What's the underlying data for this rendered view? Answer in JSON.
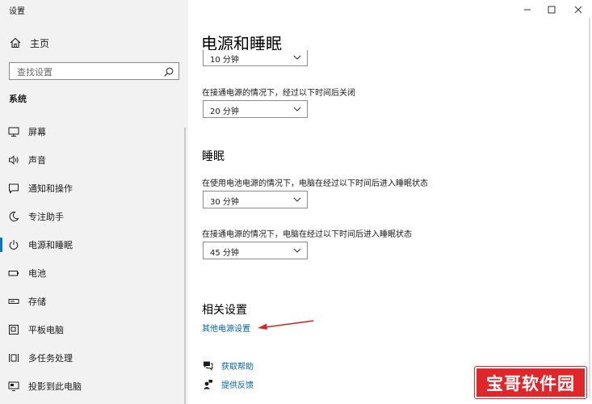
{
  "window": {
    "title": "设置"
  },
  "sidebar": {
    "home": "主页",
    "search_placeholder": "查找设置",
    "section": "系统",
    "items": [
      {
        "label": "屏幕",
        "icon": "monitor-icon"
      },
      {
        "label": "声音",
        "icon": "speaker-icon"
      },
      {
        "label": "通知和操作",
        "icon": "notification-icon"
      },
      {
        "label": "专注助手",
        "icon": "moon-icon"
      },
      {
        "label": "电源和睡眠",
        "icon": "power-icon",
        "active": true
      },
      {
        "label": "电池",
        "icon": "battery-icon"
      },
      {
        "label": "存储",
        "icon": "storage-icon"
      },
      {
        "label": "平板电脑",
        "icon": "tablet-icon"
      },
      {
        "label": "多任务处理",
        "icon": "multitask-icon"
      },
      {
        "label": "投影到此电脑",
        "icon": "project-icon"
      }
    ]
  },
  "main": {
    "title": "电源和睡眠",
    "screen": {
      "top_select": "10 分钟",
      "plugged_label": "在接通电源的情况下，经过以下时间后关闭",
      "plugged_select": "20 分钟"
    },
    "sleep": {
      "heading": "睡眠",
      "battery_label": "在使用电池电源的情况下，电脑在经过以下时间后进入睡眠状态",
      "battery_select": "30 分钟",
      "plugged_label": "在接通电源的情况下，电脑在经过以下时间后进入睡眠状态",
      "plugged_select": "45 分钟"
    },
    "related": {
      "heading": "相关设置",
      "link": "其他电源设置"
    },
    "help": {
      "get_help": "获取帮助",
      "feedback": "提供反馈"
    }
  },
  "watermark": "宝哥软件园",
  "colors": {
    "accent": "#0078d7",
    "link": "#0063b1",
    "annotation_arrow": "#d9262b",
    "watermark_bg": "#e1262a"
  }
}
